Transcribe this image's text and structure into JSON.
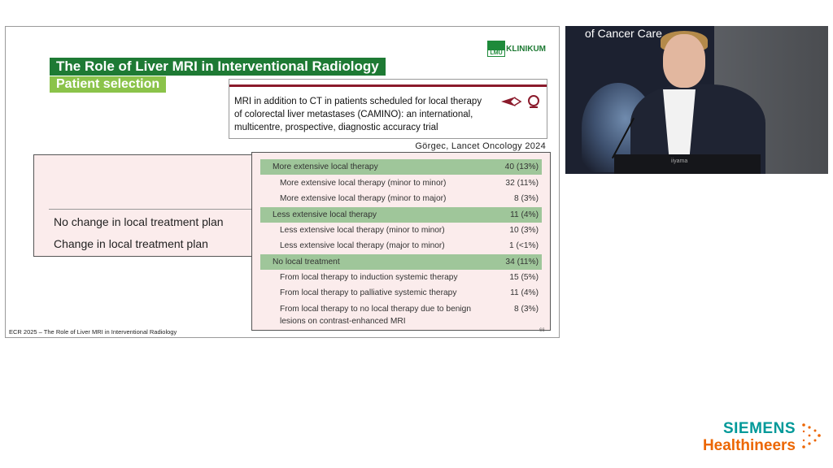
{
  "slide": {
    "title": "The Role of Liver MRI in Interventional Radiology",
    "subtitle": "Patient selection",
    "logo_box_text": "LMU",
    "logo_text": "KLINIKUM",
    "paper_title": "MRI in addition to CT in patients scheduled for local therapy of colorectal liver metastases (CAMINO): an international, multicentre, prospective, diagnostic accuracy trial",
    "citation": "Görgec, Lancet Oncology 2024",
    "left_labels": [
      "No change in local treatment plan",
      "Change in local treatment plan"
    ],
    "table_rows": [
      {
        "label": "More extensive local therapy",
        "value": "40 (13%)",
        "type": "header"
      },
      {
        "label": "More extensive local therapy (minor to minor)",
        "value": "32 (11%)",
        "type": "sub"
      },
      {
        "label": "More extensive local therapy (minor to major)",
        "value": "8 (3%)",
        "type": "sub"
      },
      {
        "label": "Less extensive local therapy",
        "value": "11 (4%)",
        "type": "header"
      },
      {
        "label": "Less extensive local therapy (minor to minor)",
        "value": "10 (3%)",
        "type": "sub"
      },
      {
        "label": "Less extensive local therapy (major to minor)",
        "value": "1 (<1%)",
        "type": "sub"
      },
      {
        "label": "No local treatment",
        "value": "34 (11%)",
        "type": "header"
      },
      {
        "label": "From local therapy to induction systemic therapy",
        "value": "15 (5%)",
        "type": "sub"
      },
      {
        "label": "From local therapy to palliative systemic therapy",
        "value": "11 (4%)",
        "type": "sub"
      },
      {
        "label": "From local therapy to no local therapy due to benign",
        "value": "8 (3%)",
        "type": "sub"
      },
      {
        "label": "lesions on contrast-enhanced MRI",
        "value": "",
        "type": "sub"
      }
    ],
    "footer": "ECR 2025 – The Role of Liver MRI in Interventional Radiology",
    "page_number": "66"
  },
  "video": {
    "banner": "of Cancer Care",
    "podium_text": "iiyama"
  },
  "brand": {
    "line1": "SIEMENS",
    "line2": "Healthineers"
  },
  "colors": {
    "title_green": "#1e7a34",
    "subtitle_green": "#8bc34a",
    "highlight": "#9fc69a",
    "siemens_teal": "#009999",
    "siemens_orange": "#ec6602"
  }
}
